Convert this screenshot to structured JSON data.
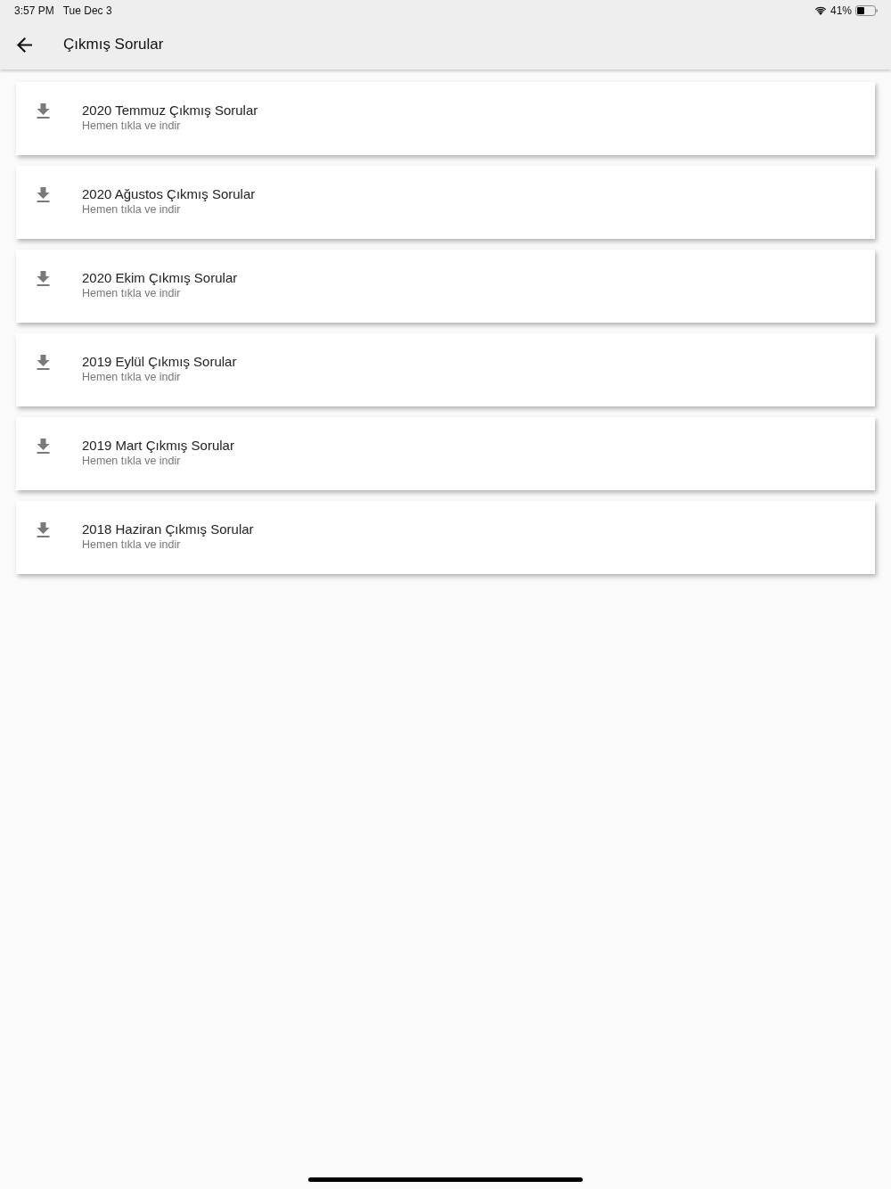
{
  "status_bar": {
    "time": "3:57 PM",
    "date": "Tue Dec 3",
    "battery": "41%"
  },
  "app_bar": {
    "title": "Çıkmış Sorular"
  },
  "items": [
    {
      "title": "2020 Temmuz Çıkmış Sorular",
      "subtitle": "Hemen tıkla ve indir"
    },
    {
      "title": "2020 Ağustos Çıkmış Sorular",
      "subtitle": "Hemen tıkla ve indir"
    },
    {
      "title": "2020 Ekim Çıkmış Sorular",
      "subtitle": "Hemen tıkla ve indir"
    },
    {
      "title": "2019 Eylül Çıkmış Sorular",
      "subtitle": "Hemen tıkla ve indir"
    },
    {
      "title": "2019 Mart Çıkmış Sorular",
      "subtitle": "Hemen tıkla ve indir"
    },
    {
      "title": "2018 Haziran Çıkmış Sorular",
      "subtitle": "Hemen tıkla ve indir"
    }
  ]
}
